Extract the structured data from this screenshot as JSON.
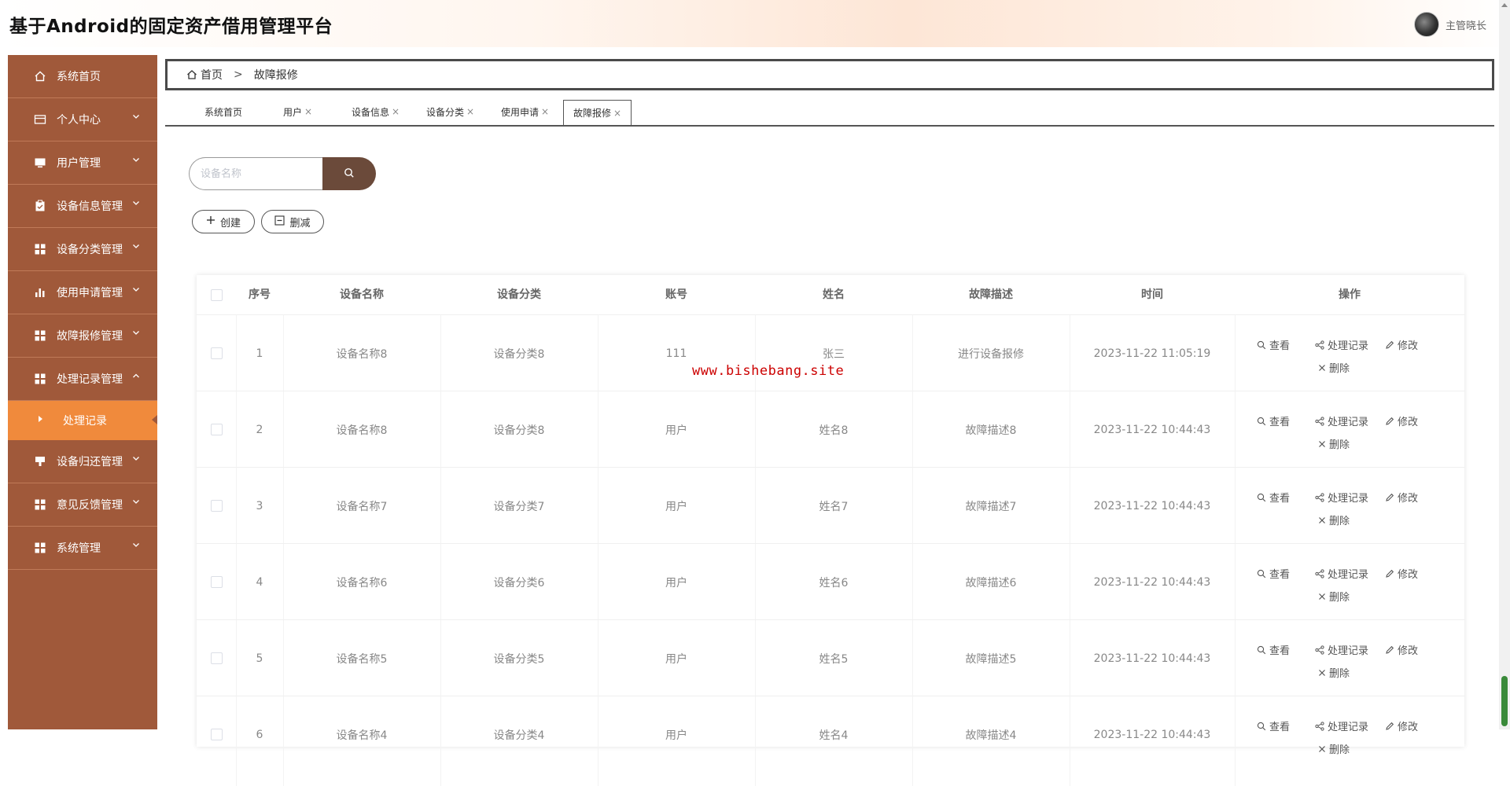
{
  "header": {
    "title": "基于Android的固定资产借用管理平台",
    "username": "主管晓长"
  },
  "sidebar": {
    "items": [
      {
        "label": "系统首页",
        "icon": "home-icon",
        "has_chevron": false
      },
      {
        "label": "个人中心",
        "icon": "card-icon",
        "has_chevron": true
      },
      {
        "label": "用户管理",
        "icon": "monitor-icon",
        "has_chevron": true
      },
      {
        "label": "设备信息管理",
        "icon": "clipboard-icon",
        "has_chevron": true
      },
      {
        "label": "设备分类管理",
        "icon": "grid-icon",
        "has_chevron": true
      },
      {
        "label": "使用申请管理",
        "icon": "bar-chart-icon",
        "has_chevron": true
      },
      {
        "label": "故障报修管理",
        "icon": "grid-icon",
        "has_chevron": true
      },
      {
        "label": "处理记录管理",
        "icon": "grid-icon",
        "has_chevron": true,
        "expanded": true
      },
      {
        "label": "设备归还管理",
        "icon": "pin-icon",
        "has_chevron": true
      },
      {
        "label": "意见反馈管理",
        "icon": "grid-icon",
        "has_chevron": true
      },
      {
        "label": "系统管理",
        "icon": "grid-icon",
        "has_chevron": true
      }
    ],
    "active_sub": "处理记录"
  },
  "breadcrumb": {
    "home": "首页",
    "separator": ">",
    "current": "故障报修"
  },
  "tabs": [
    {
      "label": "系统首页",
      "closable": false
    },
    {
      "label": "用户",
      "closable": true
    },
    {
      "label": "设备信息",
      "closable": true
    },
    {
      "label": "设备分类",
      "closable": true
    },
    {
      "label": "使用申请",
      "closable": true
    },
    {
      "label": "故障报修",
      "closable": true,
      "active": true
    }
  ],
  "tab_close": "×",
  "search": {
    "placeholder": "设备名称"
  },
  "actions": {
    "create": "创建",
    "delete": "删减"
  },
  "table": {
    "columns": [
      "序号",
      "设备名称",
      "设备分类",
      "账号",
      "姓名",
      "故障描述",
      "时间",
      "操作"
    ],
    "rows": [
      {
        "no": "1",
        "device": "设备名称8",
        "category": "设备分类8",
        "account": "111",
        "name": "张三",
        "desc": "进行设备报修",
        "time": "2023-11-22 11:05:19"
      },
      {
        "no": "2",
        "device": "设备名称8",
        "category": "设备分类8",
        "account": "用户",
        "name": "姓名8",
        "desc": "故障描述8",
        "time": "2023-11-22 10:44:43"
      },
      {
        "no": "3",
        "device": "设备名称7",
        "category": "设备分类7",
        "account": "用户",
        "name": "姓名7",
        "desc": "故障描述7",
        "time": "2023-11-22 10:44:43"
      },
      {
        "no": "4",
        "device": "设备名称6",
        "category": "设备分类6",
        "account": "用户",
        "name": "姓名6",
        "desc": "故障描述6",
        "time": "2023-11-22 10:44:43"
      },
      {
        "no": "5",
        "device": "设备名称5",
        "category": "设备分类5",
        "account": "用户",
        "name": "姓名5",
        "desc": "故障描述5",
        "time": "2023-11-22 10:44:43"
      },
      {
        "no": "6",
        "device": "设备名称4",
        "category": "设备分类4",
        "account": "用户",
        "name": "姓名4",
        "desc": "故障描述4",
        "time": "2023-11-22 10:44:43"
      }
    ],
    "ops": {
      "view": "查看",
      "records": "处理记录",
      "edit": "修改",
      "remove": "删除"
    }
  },
  "watermark": "www.bishebang.site",
  "colors": {
    "sidebar_bg": "#a0593a",
    "sidebar_active": "#f08a3c",
    "search_btn": "#6b4a3a"
  }
}
